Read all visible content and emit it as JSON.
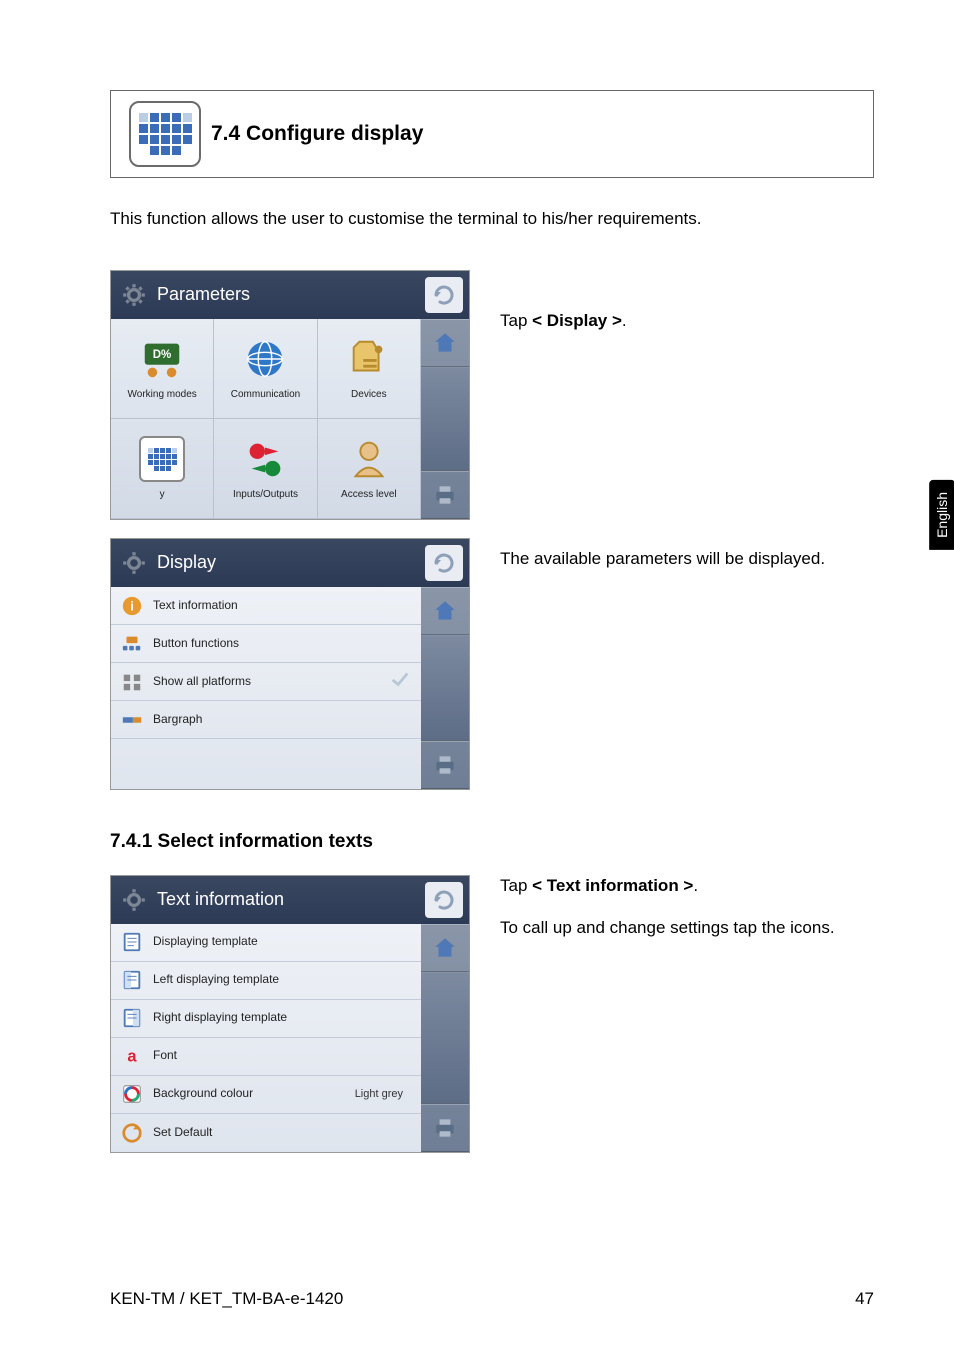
{
  "lang_tab": "English",
  "section": {
    "number_title": "7.4  Configure display",
    "intro": "This function allows the user to customise the terminal to his/her requirements."
  },
  "parameters_panel": {
    "title": "Parameters",
    "grid": {
      "working_modes": "Working modes",
      "communication": "Communication",
      "devices": "Devices",
      "display": "y",
      "inputs_outputs": "Inputs/Outputs",
      "access_level": "Access level"
    },
    "note_prefix": "Tap ",
    "note_bold": "< Display >",
    "note_suffix": "."
  },
  "display_panel": {
    "title": "Display",
    "items": {
      "text_info": "Text information",
      "button_functions": "Button functions",
      "show_all_platforms": "Show all platforms",
      "bargraph": "Bargraph"
    },
    "note": "The available parameters will be displayed."
  },
  "subsection": {
    "title": "7.4.1  Select information texts"
  },
  "textinfo_panel": {
    "title": "Text information",
    "items": {
      "displaying_template": "Displaying template",
      "left_template": "Left displaying template",
      "right_template": "Right displaying template",
      "font": "Font",
      "background_colour": "Background colour",
      "background_value": "Light grey",
      "set_default": "Set Default"
    },
    "note_line1_prefix": "Tap ",
    "note_line1_bold": "< Text information >",
    "note_line1_suffix": ".",
    "note_line2": "To call up and change settings tap the icons."
  },
  "footer": {
    "left": "KEN-TM / KET_TM-BA-e-1420",
    "right": "47"
  }
}
